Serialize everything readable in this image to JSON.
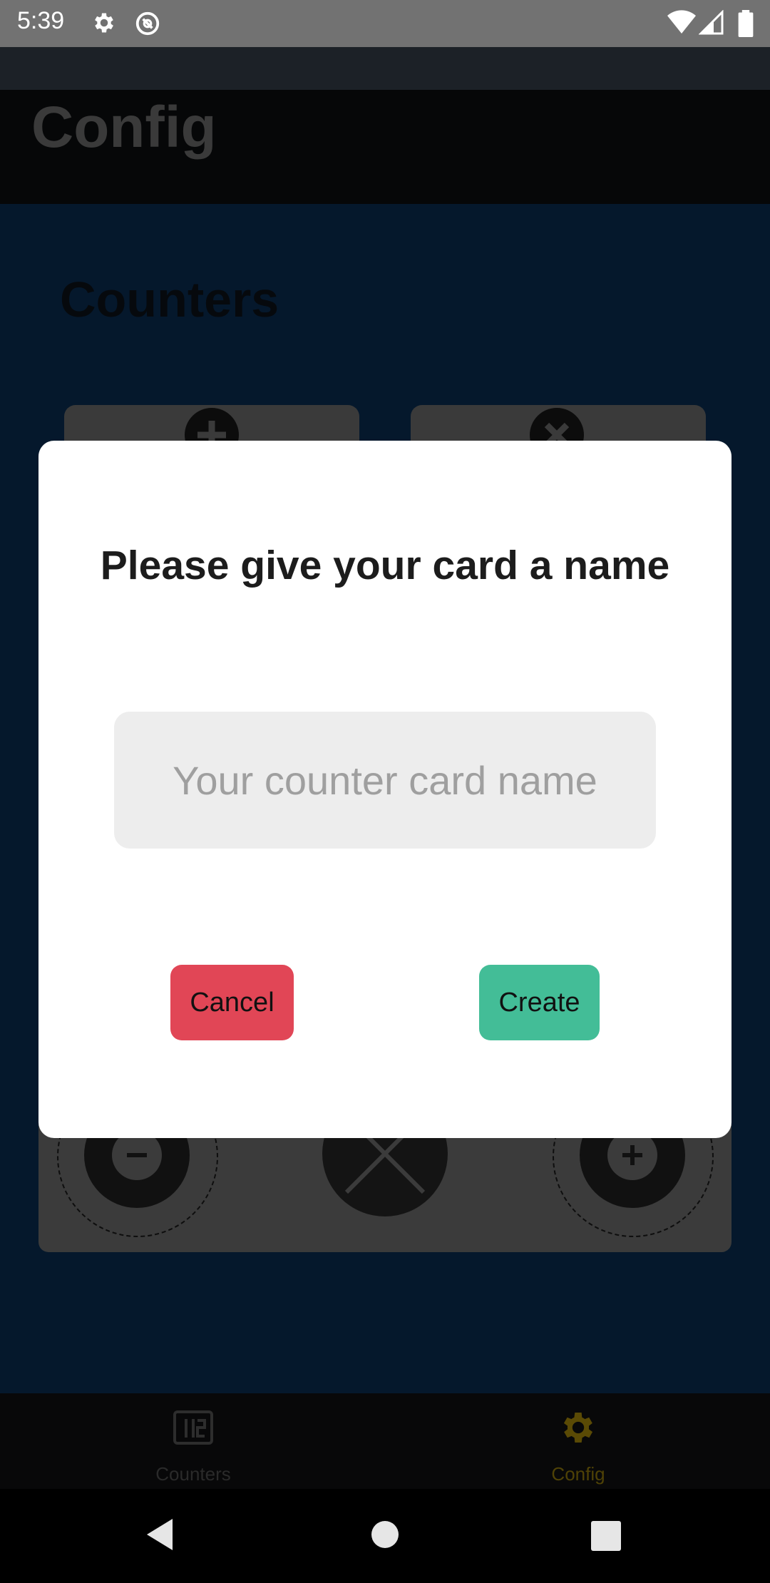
{
  "status_bar": {
    "time": "5:39",
    "left_icons": [
      "gear-icon",
      "at-sign-icon"
    ],
    "right_icons": [
      "wifi-icon",
      "signal-icon",
      "battery-icon"
    ]
  },
  "app_bar": {
    "title": "Config"
  },
  "content": {
    "section_title": "Counters",
    "top_cards": [
      {
        "icon": "plus-icon"
      },
      {
        "icon": "close-icon"
      }
    ],
    "counter_card": {
      "buttons": [
        "minus-icon",
        "close-icon",
        "plus-icon"
      ]
    }
  },
  "dialog": {
    "title": "Please give your card a name",
    "input": {
      "value": "",
      "placeholder": "Your counter card name"
    },
    "cancel_label": "Cancel",
    "create_label": "Create"
  },
  "bottom_nav": {
    "items": [
      {
        "label": "Counters",
        "icon": "counters-icon",
        "active": false
      },
      {
        "label": "Config",
        "icon": "gear-icon",
        "active": true
      }
    ]
  },
  "system_nav": {
    "icons": [
      "back-icon",
      "home-icon",
      "recents-icon"
    ]
  },
  "colors": {
    "cancel": "#e14656",
    "create": "#43bd97",
    "active_nav": "#5a4a05",
    "background": "#05182c"
  }
}
